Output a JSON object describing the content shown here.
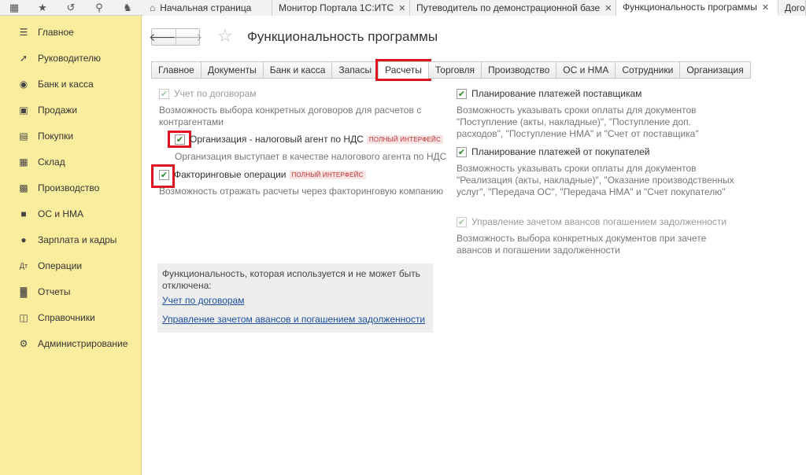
{
  "window_tabs": [
    {
      "label": "Начальная страница",
      "active": false,
      "closable": false
    },
    {
      "label": "Монитор Портала 1С:ИТС",
      "active": false,
      "closable": true
    },
    {
      "label": "Путеводитель по демонстрационной базе",
      "active": false,
      "closable": true
    },
    {
      "label": "Функциональность программы",
      "active": true,
      "closable": true
    },
    {
      "label": "Дого",
      "active": false,
      "closable": false
    }
  ],
  "sidebar": {
    "items": [
      {
        "label": "Главное",
        "icon": "menu-lines-icon"
      },
      {
        "label": "Руководителю",
        "icon": "trend-icon"
      },
      {
        "label": "Банк и касса",
        "icon": "ruble-coin-icon"
      },
      {
        "label": "Продажи",
        "icon": "bag-icon"
      },
      {
        "label": "Покупки",
        "icon": "cart-icon"
      },
      {
        "label": "Склад",
        "icon": "warehouse-icon"
      },
      {
        "label": "Производство",
        "icon": "factory-icon"
      },
      {
        "label": "ОС и НМА",
        "icon": "truck-icon"
      },
      {
        "label": "Зарплата и кадры",
        "icon": "people-icon"
      },
      {
        "label": "Операции",
        "icon": "debit-credit-icon"
      },
      {
        "label": "Отчеты",
        "icon": "bar-chart-icon"
      },
      {
        "label": "Справочники",
        "icon": "book-icon"
      },
      {
        "label": "Администрирование",
        "icon": "gear-icon"
      }
    ]
  },
  "page": {
    "title": "Функциональность программы",
    "back_glyph": "🡐",
    "forward_glyph": "🡒"
  },
  "tabs": [
    "Главное",
    "Документы",
    "Банк и касса",
    "Запасы",
    "Расчеты",
    "Торговля",
    "Производство",
    "ОС и НМА",
    "Сотрудники",
    "Организация"
  ],
  "active_tab": "Расчеты",
  "badge_text": "ПОЛНЫЙ ИНТЕРФЕЙС",
  "left_column": {
    "contracts": {
      "label": "Учет по договорам",
      "checked": true,
      "disabled": true,
      "description": "Возможность выбора конкретных договоров для расчетов с контрагентами"
    },
    "tax_agent": {
      "label": "Организация - налоговый агент по НДС",
      "checked": true,
      "description": "Организация выступает в качестве налогового агента по НДС"
    },
    "factoring": {
      "label": "Факторинговые операции",
      "checked": true,
      "description": "Возможность отражать расчеты через факторинговую компанию"
    }
  },
  "right_column": {
    "supplier_payments": {
      "label": "Планирование платежей поставщикам",
      "checked": true,
      "description": "Возможность указывать сроки оплаты для документов \"Поступление (акты, накладные)\", \"Поступление доп. расходов\", \"Поступление НМА\" и \"Счет от поставщика\""
    },
    "customer_payments": {
      "label": "Планирование платежей от покупателей",
      "checked": true,
      "description": "Возможность указывать сроки оплаты для документов \"Реализация (акты, накладные)\", \"Оказание производственных услуг\", \"Передача ОС\", \"Передача НМА\" и \"Счет покупателю\""
    },
    "advances": {
      "label": "Управление зачетом авансов погашением задолженности",
      "checked": true,
      "disabled": true,
      "description": "Возможность выбора конкретных документов при зачете авансов и погашении задолженности"
    }
  },
  "info_box": {
    "text": "Функциональность, которая используется и не может быть отключена:",
    "links": [
      "Учет по договорам",
      "Управление зачетом авансов и погашением задолженности"
    ]
  }
}
